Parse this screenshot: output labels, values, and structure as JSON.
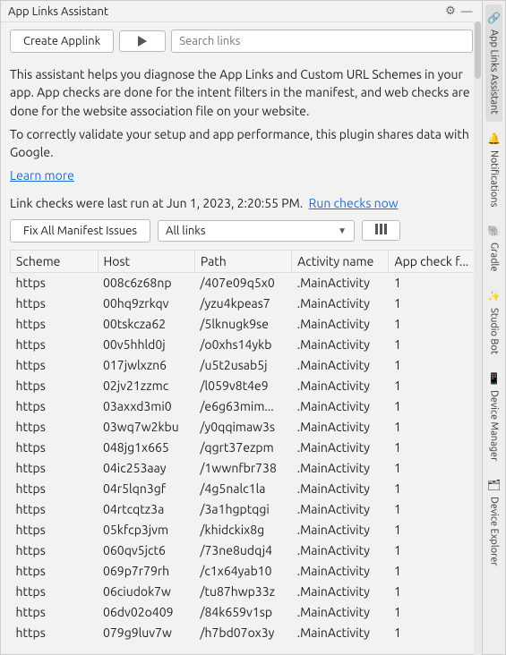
{
  "title": "App Links Assistant",
  "toolbar": {
    "create_label": "Create Applink",
    "search_placeholder": "Search links"
  },
  "desc_p1": "This assistant helps you diagnose the App Links and Custom URL Schemes in your app. App checks are done for the intent filters in the manifest, and web checks are done for the website association file on your website.",
  "desc_p2": "To correctly validate your setup and app performance, this plugin shares data with Google.",
  "learn_more": "Learn more",
  "status_prefix": "Link checks were last run at ",
  "status_time": "Jun 1, 2023, 2:20:55 PM.",
  "run_checks": "Run checks now",
  "fix_label": "Fix All Manifest Issues",
  "filter_label": "All links",
  "columns": [
    "Scheme",
    "Host",
    "Path",
    "Activity name",
    "App check f..."
  ],
  "rows": [
    {
      "scheme": "https",
      "host": "008c6z68np",
      "path": "/407e09q5x0",
      "activity": ".MainActivity",
      "appcheck": "1"
    },
    {
      "scheme": "https",
      "host": "00hq9zrkqv",
      "path": "/yzu4kpeas7",
      "activity": ".MainActivity",
      "appcheck": "1"
    },
    {
      "scheme": "https",
      "host": "00tskcza62",
      "path": "/5lknugk9se",
      "activity": ".MainActivity",
      "appcheck": "1"
    },
    {
      "scheme": "https",
      "host": "00v5hhld0j",
      "path": "/o0xhs14ykb",
      "activity": ".MainActivity",
      "appcheck": "1"
    },
    {
      "scheme": "https",
      "host": "017jwlxzn6",
      "path": "/u5t2usab5j",
      "activity": ".MainActivity",
      "appcheck": "1"
    },
    {
      "scheme": "https",
      "host": "02jv21zzmc",
      "path": "/l059v8t4e9",
      "activity": ".MainActivity",
      "appcheck": "1"
    },
    {
      "scheme": "https",
      "host": "03axxd3mi0",
      "path": "/e6g63mim...",
      "activity": ".MainActivity",
      "appcheck": "1"
    },
    {
      "scheme": "https",
      "host": "03wq7w2kbu",
      "path": "/y0qqimaw3s",
      "activity": ".MainActivity",
      "appcheck": "1"
    },
    {
      "scheme": "https",
      "host": "048jg1x665",
      "path": "/qgrt37ezpm",
      "activity": ".MainActivity",
      "appcheck": "1"
    },
    {
      "scheme": "https",
      "host": "04ic253aay",
      "path": "/1wwnfbr738",
      "activity": ".MainActivity",
      "appcheck": "1"
    },
    {
      "scheme": "https",
      "host": "04r5lqn3gf",
      "path": "/4g5nalc1la",
      "activity": ".MainActivity",
      "appcheck": "1"
    },
    {
      "scheme": "https",
      "host": "04rtcqtz3a",
      "path": "/3a1hgptqgi",
      "activity": ".MainActivity",
      "appcheck": "1"
    },
    {
      "scheme": "https",
      "host": "05kfcp3jvm",
      "path": "/khidckix8g",
      "activity": ".MainActivity",
      "appcheck": "1"
    },
    {
      "scheme": "https",
      "host": "060qv5jct6",
      "path": "/73ne8udqj4",
      "activity": ".MainActivity",
      "appcheck": "1"
    },
    {
      "scheme": "https",
      "host": "069p7r79rh",
      "path": "/c1x64yab10",
      "activity": ".MainActivity",
      "appcheck": "1"
    },
    {
      "scheme": "https",
      "host": "06ciudok7w",
      "path": "/tu87hwp33z",
      "activity": ".MainActivity",
      "appcheck": "1"
    },
    {
      "scheme": "https",
      "host": "06dv02o409",
      "path": "/84k659v1sp",
      "activity": ".MainActivity",
      "appcheck": "1"
    },
    {
      "scheme": "https",
      "host": "079g9luv7w",
      "path": "/h7bd07ox3y",
      "activity": ".MainActivity",
      "appcheck": "1"
    }
  ],
  "sidetabs": [
    {
      "icon": "🔗",
      "label": "App Links Assistant",
      "active": true
    },
    {
      "icon": "🔔",
      "label": "Notifications",
      "active": false
    },
    {
      "icon": "🐘",
      "label": "Gradle",
      "active": false
    },
    {
      "icon": "✨",
      "label": "Studio Bot",
      "active": false
    },
    {
      "icon": "📱",
      "label": "Device Manager",
      "active": false
    },
    {
      "icon": "🗂",
      "label": "Device Explorer",
      "active": false
    }
  ]
}
